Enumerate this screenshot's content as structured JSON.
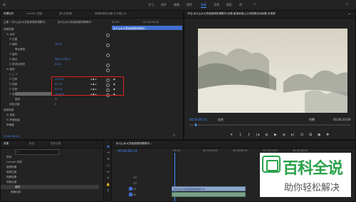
{
  "topbar": {
    "workspace_tabs": [
      "学习",
      "组件",
      "编辑",
      "颜色",
      "效果",
      "音频",
      "图形",
      "库"
    ],
    "active_tab": "效果"
  },
  "effect_controls": {
    "tabs": [
      "效果控件",
      "Lumetri 范围",
      "源:(无剪辑)",
      "音频剪辑混合器:长沙湘江大..."
    ],
    "header_clip": "主要 * 余凡山水大意画视频剪辑素材...",
    "header_seq": "余凡山水大意画视频剪辑素材...",
    "timecode_ruler": "00;00",
    "timecode_ruler2": "00;00;04;00",
    "clip_bar_label": "余凡山水大意画视频剪辑素材-...",
    "rows": {
      "video_effects": "视频效果",
      "motion": "fx  运动",
      "position": "Ö 位置",
      "scale": "Ö 缩放",
      "scale_value": "100.0",
      "scale_width": "等比缩放",
      "rotation": "Ö 旋转",
      "anchor": "Ö 锚点",
      "anchor_value": "960.0  540.0",
      "flicker": "Ö 防闪烁滤镜",
      "flicker_value": "0.00",
      "crop": "fx  裁剪",
      "left": "Ö 左侧",
      "left_value": "22.0 %",
      "top": "Ö 顶部",
      "top_value": "0.0 %",
      "right": "Ö 右侧",
      "right_value": "0.0 %",
      "bottom": "Ö 底部",
      "bottom_value": "12.0 %",
      "zoom": "缩放",
      "feather": "羽化边缘",
      "feather_value": "0",
      "audio_effects": "音频效果",
      "volume": "fx  音量",
      "channel_volume": "fx  声道音量",
      "panner": "声像器"
    },
    "bottom_timecode": "00;00;06;14"
  },
  "program": {
    "title": "节目:余凡山水大意画视频剪辑素材-标题-星落雨落山之前视频自动标题-无视频",
    "timecode": "00;00;06;14",
    "fit": "适合",
    "quality": "完整",
    "duration": "00;00;10;00"
  },
  "project": {
    "tabs": [
      "效果",
      "标记",
      "历史记录"
    ],
    "search_placeholder": "",
    "tree": [
      "预设",
      "Lumetri 预设",
      "音频效果",
      "音频过渡",
      "视频效果",
      "视频过渡",
      "变换",
      "裁剪",
      "图像控制"
    ],
    "selected": "裁剪"
  },
  "timeline": {
    "sequence_name": "余凡山水大意画视频剪辑素材-...",
    "timecode": "00;00;06;14",
    "ruler": [
      "00;00",
      "00;00;04;00",
      "00;00;08;00",
      "00;00;12;00",
      "00;00;16;00"
    ],
    "video_tracks": [
      "V3",
      "V2",
      "V1"
    ],
    "audio_tracks": [
      "A1",
      "A2",
      "A3"
    ],
    "clip_label": "余凡山水大意画视频剪辑素材 [V]"
  },
  "watermark": {
    "title": "百科全说",
    "subtitle": "助你轻松解决"
  },
  "colors": {
    "accent": "#3f8fff",
    "highlight_box": "#e02020",
    "watermark_green": "#2aa14a"
  }
}
